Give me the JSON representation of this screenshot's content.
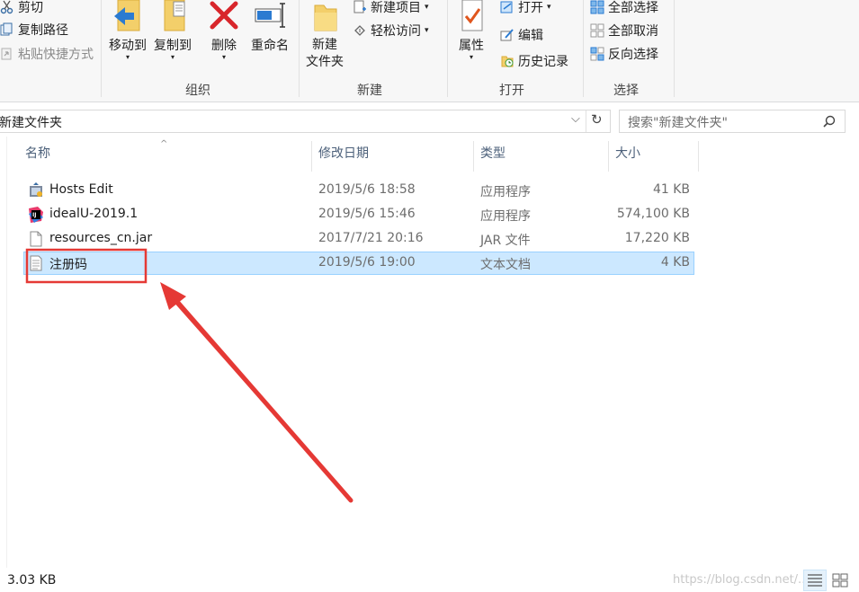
{
  "ribbon": {
    "clipboard": {
      "cut": "剪切",
      "copy_path": "复制路径",
      "paste_shortcut": "粘贴快捷方式"
    },
    "organize": {
      "move_to": "移动到",
      "copy_to": "复制到",
      "delete": "删除",
      "rename": "重命名",
      "group": "组织"
    },
    "new": {
      "new_folder_line1": "新建",
      "new_folder_line2": "文件夹",
      "new_item": "新建项目",
      "easy_access": "轻松访问",
      "group": "新建"
    },
    "open": {
      "properties": "属性",
      "open": "打开",
      "edit": "编辑",
      "history": "历史记录",
      "group": "打开"
    },
    "select": {
      "select_all": "全部选择",
      "select_none": "全部取消",
      "invert": "反向选择",
      "group": "选择"
    }
  },
  "address": {
    "path": "新建文件夹",
    "search_placeholder": "搜索\"新建文件夹\""
  },
  "columns": {
    "name": "名称",
    "date": "修改日期",
    "type": "类型",
    "size": "大小"
  },
  "files": [
    {
      "name": "Hosts Edit",
      "date": "2019/5/6 18:58",
      "type": "应用程序",
      "size": "41 KB",
      "icon": "hosts-edit-app-icon"
    },
    {
      "name": "idealU-2019.1",
      "date": "2019/5/6 15:46",
      "type": "应用程序",
      "size": "574,100 KB",
      "icon": "intellij-idea-icon"
    },
    {
      "name": "resources_cn.jar",
      "date": "2017/7/21 20:16",
      "type": "JAR 文件",
      "size": "17,220 KB",
      "icon": "jar-file-icon"
    },
    {
      "name": "注册码",
      "date": "2019/5/6 19:00",
      "type": "文本文档",
      "size": "4 KB",
      "icon": "text-document-icon"
    }
  ],
  "status": {
    "selection_size": "3.03 KB",
    "watermark": "https://blog.csdn.net/..."
  },
  "colors": {
    "selection": "#cce8ff",
    "annotation": "#e53935"
  }
}
